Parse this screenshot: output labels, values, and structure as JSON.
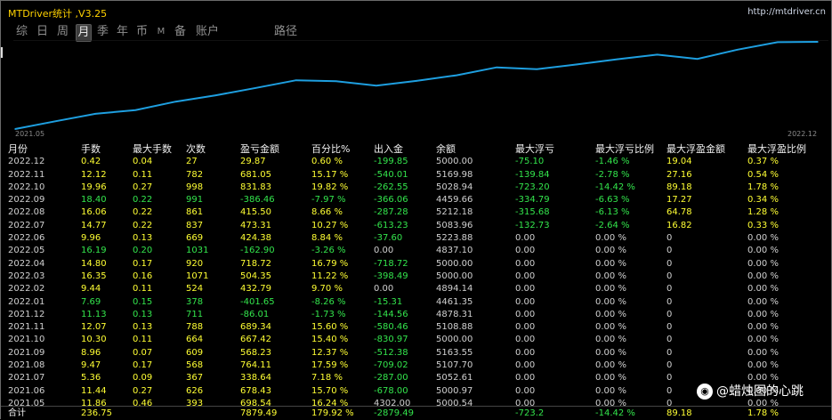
{
  "window": {
    "title": "MTDriver统计 ,V3.25",
    "url": "http://mtdriver.cn"
  },
  "tabs": [
    {
      "label": "综",
      "active": false
    },
    {
      "label": "日",
      "active": false
    },
    {
      "label": "周",
      "active": false
    },
    {
      "label": "月",
      "active": true
    },
    {
      "label": "季",
      "active": false
    },
    {
      "label": "年",
      "active": false
    },
    {
      "label": "币",
      "active": false
    },
    {
      "label": "M",
      "active": false
    },
    {
      "label": "备",
      "active": false
    },
    {
      "label": "账户",
      "active": false
    },
    {
      "label": "路径",
      "active": false
    }
  ],
  "chart_data": {
    "type": "line",
    "x_start_label": "2021.05",
    "x_end_label": "2022.12",
    "line_color": "#1e9fe0",
    "x": [
      "2021.05",
      "2021.06",
      "2021.07",
      "2021.08",
      "2021.09",
      "2021.10",
      "2021.11",
      "2021.12",
      "2022.01",
      "2022.02",
      "2022.03",
      "2022.04",
      "2022.05",
      "2022.06",
      "2022.07",
      "2022.08",
      "2022.09",
      "2022.10",
      "2022.11",
      "2022.12"
    ],
    "y": [
      5000.54,
      5000.97,
      5052.61,
      5107.7,
      5163.55,
      5000.0,
      5108.88,
      4878.31,
      4461.35,
      4894.14,
      5000.0,
      5000.0,
      4837.1,
      5223.88,
      5083.96,
      5212.18,
      4459.66,
      5028.94,
      5169.98,
      5000.0
    ],
    "values": [
      0,
      698.54,
      1376.97,
      1715.61,
      2479.72,
      3047.95,
      3715.37,
      4404.71,
      4318.7,
      3917.05,
      4349.84,
      4854.19,
      5572.91,
      5410.01,
      5834.39,
      6307.7,
      6723.2,
      6337.74,
      7169.57,
      7850.62,
      7880.49
    ],
    "grid": false,
    "legend": "none"
  },
  "table": {
    "headers": [
      "月份",
      "手数",
      "最大手数",
      "次数",
      "盈亏金额",
      "百分比%",
      "出入金",
      "余额",
      "最大浮亏",
      "最大浮亏比例",
      "最大浮盈金额",
      "最大浮盈比例"
    ],
    "rows": [
      [
        "2022.12",
        "0.42",
        "0.04",
        "27",
        "29.87",
        "0.60 %",
        "-199.85",
        "5000.00",
        "-75.10",
        "-1.46 %",
        "19.04",
        "0.37 %"
      ],
      [
        "2022.11",
        "12.12",
        "0.11",
        "782",
        "681.05",
        "15.17 %",
        "-540.01",
        "5169.98",
        "-139.84",
        "-2.78 %",
        "27.16",
        "0.54 %"
      ],
      [
        "2022.10",
        "19.96",
        "0.27",
        "998",
        "831.83",
        "19.82 %",
        "-262.55",
        "5028.94",
        "-723.20",
        "-14.42 %",
        "89.18",
        "1.78 %"
      ],
      [
        "2022.09",
        "18.40",
        "0.22",
        "991",
        "-386.46",
        "-7.97 %",
        "-366.06",
        "4459.66",
        "-334.79",
        "-6.63 %",
        "17.27",
        "0.34 %"
      ],
      [
        "2022.08",
        "16.06",
        "0.22",
        "861",
        "415.50",
        "8.66 %",
        "-287.28",
        "5212.18",
        "-315.68",
        "-6.13 %",
        "64.78",
        "1.28 %"
      ],
      [
        "2022.07",
        "14.77",
        "0.22",
        "837",
        "473.31",
        "10.27 %",
        "-613.23",
        "5083.96",
        "-132.73",
        "-2.64 %",
        "16.82",
        "0.33 %"
      ],
      [
        "2022.06",
        "9.96",
        "0.13",
        "669",
        "424.38",
        "8.84 %",
        "-37.60",
        "5223.88",
        "0.00",
        "0.00 %",
        "0",
        "0.00 %"
      ],
      [
        "2022.05",
        "16.19",
        "0.20",
        "1031",
        "-162.90",
        "-3.26 %",
        "0.00",
        "4837.10",
        "0.00",
        "0.00 %",
        "0",
        "0.00 %"
      ],
      [
        "2022.04",
        "14.80",
        "0.17",
        "920",
        "718.72",
        "16.79 %",
        "-718.72",
        "5000.00",
        "0.00",
        "0.00 %",
        "0",
        "0.00 %"
      ],
      [
        "2022.03",
        "16.35",
        "0.16",
        "1071",
        "504.35",
        "11.22 %",
        "-398.49",
        "5000.00",
        "0.00",
        "0.00 %",
        "0",
        "0.00 %"
      ],
      [
        "2022.02",
        "9.44",
        "0.11",
        "524",
        "432.79",
        "9.70 %",
        "0.00",
        "4894.14",
        "0.00",
        "0.00 %",
        "0",
        "0.00 %"
      ],
      [
        "2022.01",
        "7.69",
        "0.15",
        "378",
        "-401.65",
        "-8.26 %",
        "-15.31",
        "4461.35",
        "0.00",
        "0.00 %",
        "0",
        "0.00 %"
      ],
      [
        "2021.12",
        "11.13",
        "0.13",
        "711",
        "-86.01",
        "-1.73 %",
        "-144.56",
        "4878.31",
        "0.00",
        "0.00 %",
        "0",
        "0.00 %"
      ],
      [
        "2021.11",
        "12.07",
        "0.13",
        "788",
        "689.34",
        "15.60 %",
        "-580.46",
        "5108.88",
        "0.00",
        "0.00 %",
        "0",
        "0.00 %"
      ],
      [
        "2021.10",
        "10.30",
        "0.11",
        "664",
        "667.42",
        "15.40 %",
        "-830.97",
        "5000.00",
        "0.00",
        "0.00 %",
        "0",
        "0.00 %"
      ],
      [
        "2021.09",
        "8.96",
        "0.07",
        "609",
        "568.23",
        "12.37 %",
        "-512.38",
        "5163.55",
        "0.00",
        "0.00 %",
        "0",
        "0.00 %"
      ],
      [
        "2021.08",
        "9.47",
        "0.17",
        "568",
        "764.11",
        "17.59 %",
        "-709.02",
        "5107.70",
        "0.00",
        "0.00 %",
        "0",
        "0.00 %"
      ],
      [
        "2021.07",
        "5.36",
        "0.09",
        "367",
        "338.64",
        "7.18 %",
        "-287.00",
        "5052.61",
        "0.00",
        "0.00 %",
        "0",
        "0.00 %"
      ],
      [
        "2021.06",
        "11.44",
        "0.27",
        "626",
        "678.43",
        "15.70 %",
        "-678.00",
        "5000.97",
        "0.00",
        "0.00 %",
        "0",
        "0.00 %"
      ],
      [
        "2021.05",
        "11.86",
        "0.46",
        "393",
        "698.54",
        "16.24 %",
        "4302.00",
        "5000.54",
        "0.00",
        "0.00 %",
        "0",
        "0.00 %"
      ]
    ],
    "total": [
      "合计",
      "236.75",
      "",
      "",
      "7879.49",
      "179.92 %",
      "-2879.49",
      "",
      "-723.2",
      "-14.42 %",
      "89.18",
      "1.78 %"
    ]
  },
  "watermark": {
    "icon": "wechat-icon",
    "text": "@蜡烛图的心跳"
  },
  "colors": {
    "positive": "#ffff33",
    "negative": "#33e54c",
    "accent": "#ffd200",
    "line": "#1e9fe0"
  }
}
